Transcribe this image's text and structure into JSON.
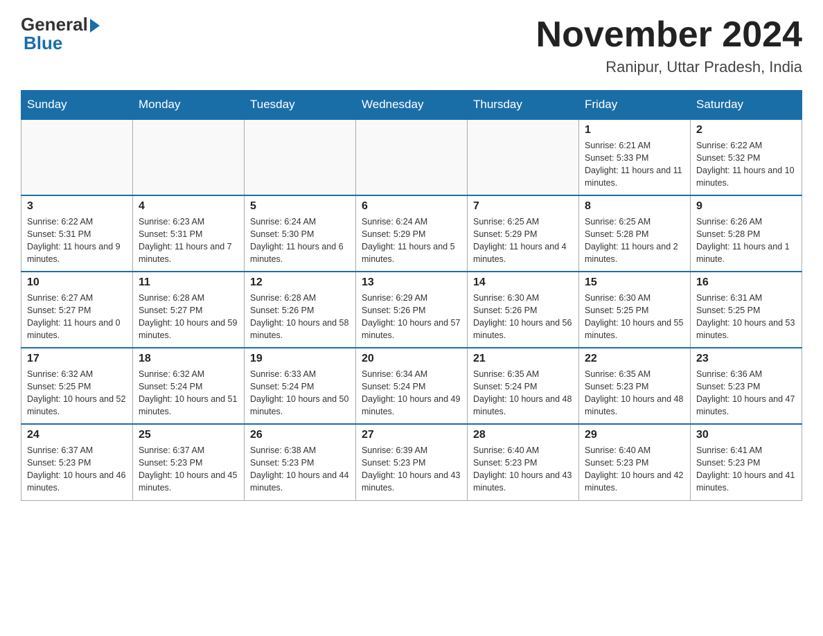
{
  "header": {
    "logo_general": "General",
    "logo_blue": "Blue",
    "main_title": "November 2024",
    "subtitle": "Ranipur, Uttar Pradesh, India"
  },
  "days_of_week": [
    "Sunday",
    "Monday",
    "Tuesday",
    "Wednesday",
    "Thursday",
    "Friday",
    "Saturday"
  ],
  "weeks": [
    [
      {
        "day": "",
        "info": ""
      },
      {
        "day": "",
        "info": ""
      },
      {
        "day": "",
        "info": ""
      },
      {
        "day": "",
        "info": ""
      },
      {
        "day": "",
        "info": ""
      },
      {
        "day": "1",
        "info": "Sunrise: 6:21 AM\nSunset: 5:33 PM\nDaylight: 11 hours and 11 minutes."
      },
      {
        "day": "2",
        "info": "Sunrise: 6:22 AM\nSunset: 5:32 PM\nDaylight: 11 hours and 10 minutes."
      }
    ],
    [
      {
        "day": "3",
        "info": "Sunrise: 6:22 AM\nSunset: 5:31 PM\nDaylight: 11 hours and 9 minutes."
      },
      {
        "day": "4",
        "info": "Sunrise: 6:23 AM\nSunset: 5:31 PM\nDaylight: 11 hours and 7 minutes."
      },
      {
        "day": "5",
        "info": "Sunrise: 6:24 AM\nSunset: 5:30 PM\nDaylight: 11 hours and 6 minutes."
      },
      {
        "day": "6",
        "info": "Sunrise: 6:24 AM\nSunset: 5:29 PM\nDaylight: 11 hours and 5 minutes."
      },
      {
        "day": "7",
        "info": "Sunrise: 6:25 AM\nSunset: 5:29 PM\nDaylight: 11 hours and 4 minutes."
      },
      {
        "day": "8",
        "info": "Sunrise: 6:25 AM\nSunset: 5:28 PM\nDaylight: 11 hours and 2 minutes."
      },
      {
        "day": "9",
        "info": "Sunrise: 6:26 AM\nSunset: 5:28 PM\nDaylight: 11 hours and 1 minute."
      }
    ],
    [
      {
        "day": "10",
        "info": "Sunrise: 6:27 AM\nSunset: 5:27 PM\nDaylight: 11 hours and 0 minutes."
      },
      {
        "day": "11",
        "info": "Sunrise: 6:28 AM\nSunset: 5:27 PM\nDaylight: 10 hours and 59 minutes."
      },
      {
        "day": "12",
        "info": "Sunrise: 6:28 AM\nSunset: 5:26 PM\nDaylight: 10 hours and 58 minutes."
      },
      {
        "day": "13",
        "info": "Sunrise: 6:29 AM\nSunset: 5:26 PM\nDaylight: 10 hours and 57 minutes."
      },
      {
        "day": "14",
        "info": "Sunrise: 6:30 AM\nSunset: 5:26 PM\nDaylight: 10 hours and 56 minutes."
      },
      {
        "day": "15",
        "info": "Sunrise: 6:30 AM\nSunset: 5:25 PM\nDaylight: 10 hours and 55 minutes."
      },
      {
        "day": "16",
        "info": "Sunrise: 6:31 AM\nSunset: 5:25 PM\nDaylight: 10 hours and 53 minutes."
      }
    ],
    [
      {
        "day": "17",
        "info": "Sunrise: 6:32 AM\nSunset: 5:25 PM\nDaylight: 10 hours and 52 minutes."
      },
      {
        "day": "18",
        "info": "Sunrise: 6:32 AM\nSunset: 5:24 PM\nDaylight: 10 hours and 51 minutes."
      },
      {
        "day": "19",
        "info": "Sunrise: 6:33 AM\nSunset: 5:24 PM\nDaylight: 10 hours and 50 minutes."
      },
      {
        "day": "20",
        "info": "Sunrise: 6:34 AM\nSunset: 5:24 PM\nDaylight: 10 hours and 49 minutes."
      },
      {
        "day": "21",
        "info": "Sunrise: 6:35 AM\nSunset: 5:24 PM\nDaylight: 10 hours and 48 minutes."
      },
      {
        "day": "22",
        "info": "Sunrise: 6:35 AM\nSunset: 5:23 PM\nDaylight: 10 hours and 48 minutes."
      },
      {
        "day": "23",
        "info": "Sunrise: 6:36 AM\nSunset: 5:23 PM\nDaylight: 10 hours and 47 minutes."
      }
    ],
    [
      {
        "day": "24",
        "info": "Sunrise: 6:37 AM\nSunset: 5:23 PM\nDaylight: 10 hours and 46 minutes."
      },
      {
        "day": "25",
        "info": "Sunrise: 6:37 AM\nSunset: 5:23 PM\nDaylight: 10 hours and 45 minutes."
      },
      {
        "day": "26",
        "info": "Sunrise: 6:38 AM\nSunset: 5:23 PM\nDaylight: 10 hours and 44 minutes."
      },
      {
        "day": "27",
        "info": "Sunrise: 6:39 AM\nSunset: 5:23 PM\nDaylight: 10 hours and 43 minutes."
      },
      {
        "day": "28",
        "info": "Sunrise: 6:40 AM\nSunset: 5:23 PM\nDaylight: 10 hours and 43 minutes."
      },
      {
        "day": "29",
        "info": "Sunrise: 6:40 AM\nSunset: 5:23 PM\nDaylight: 10 hours and 42 minutes."
      },
      {
        "day": "30",
        "info": "Sunrise: 6:41 AM\nSunset: 5:23 PM\nDaylight: 10 hours and 41 minutes."
      }
    ]
  ]
}
